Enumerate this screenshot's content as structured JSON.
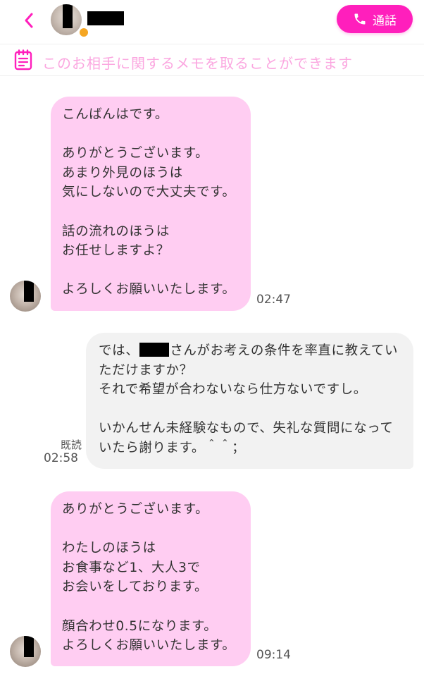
{
  "header": {
    "call_label": "通話"
  },
  "memo": {
    "placeholder": "このお相手に関するメモを取ることができます"
  },
  "messages": [
    {
      "direction": "incoming",
      "text": "こんばんはです。\n\nありがとうございます。\nあまり外見のほうは\n気にしないので大丈夫です。\n\n話の流れのほうは\nお任せしますよ？\n\nよろしくお願いいたします。",
      "time": "02:47"
    },
    {
      "direction": "outgoing",
      "text_before_name": "では、",
      "text_after_name": "さんがお考えの条件を率直に教えていただけますか？\nそれで希望が合わないなら仕方ないですし。\n\nいかんせん未経験なもので、失礼な質問になっていたら謝ります。＾＾；",
      "read_label": "既読",
      "time": "02:58"
    },
    {
      "direction": "incoming",
      "text": "ありがとうございます。\n\nわたしのほうは\nお食事など1、大人3で\nお会いをしております。\n\n顔合わせ0.5になります。\nよろしくお願いいたします。",
      "time": "09:14"
    }
  ],
  "colors": {
    "accent": "#ff1fbc",
    "incoming_bubble": "#ffcdf2",
    "outgoing_bubble": "#f2f2f2",
    "memo_text": "#fba7e0",
    "online_dot": "#f5a623"
  },
  "icons": {
    "back": "chevron-left-icon",
    "call": "phone-icon",
    "memo": "notepad-icon"
  }
}
